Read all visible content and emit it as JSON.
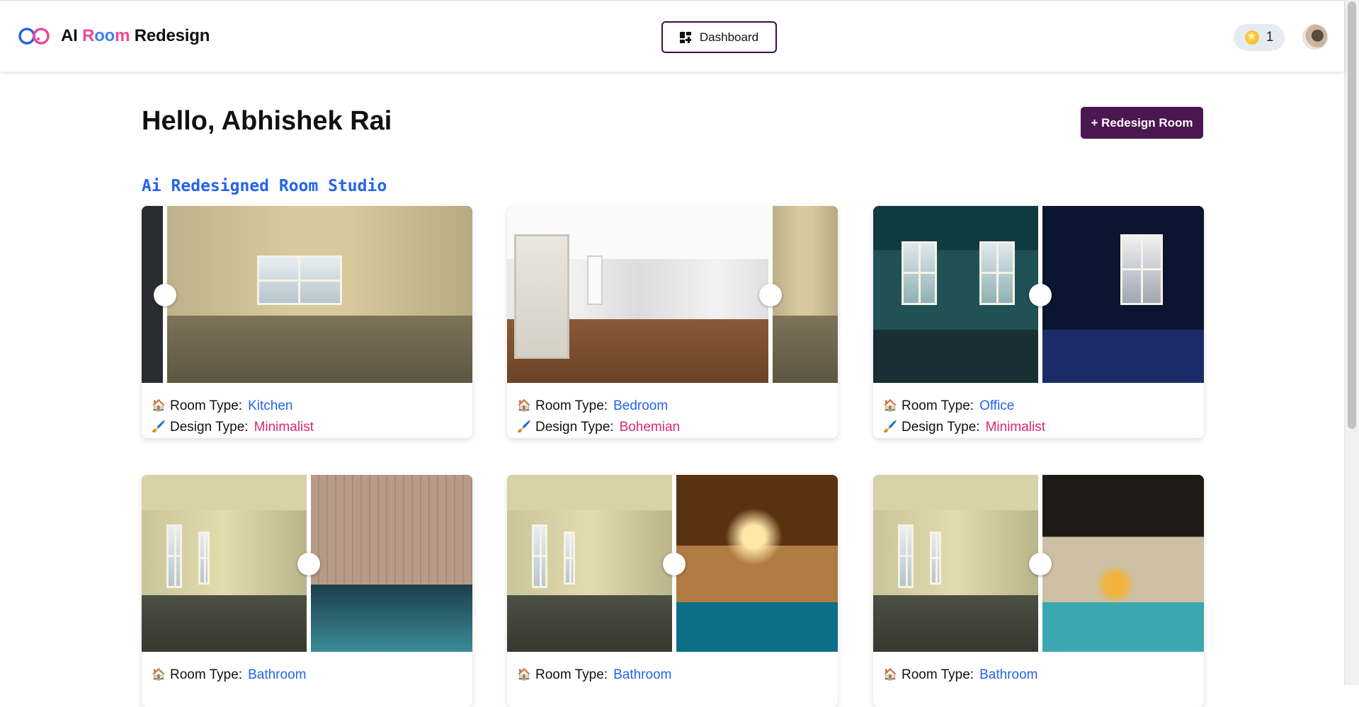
{
  "app": {
    "name_part1": "AI",
    "name_part2_room_r": "R",
    "name_part2_room_o": "oo",
    "name_part2_room_m": "m",
    "name_part3": "Redesign"
  },
  "header": {
    "dashboard_label": "Dashboard",
    "credits": "1"
  },
  "main": {
    "greeting": "Hello, Abhishek Rai",
    "redesign_button": "+ Redesign Room",
    "studio_title": "Ai Redesigned Room Studio",
    "room_type_label": "Room Type:",
    "design_type_label": "Design Type:"
  },
  "cards": [
    {
      "room_type": "Kitchen",
      "design_type": "Minimalist"
    },
    {
      "room_type": "Bedroom",
      "design_type": "Bohemian"
    },
    {
      "room_type": "Office",
      "design_type": "Minimalist"
    },
    {
      "room_type": "Bathroom",
      "design_type": ""
    },
    {
      "room_type": "Bathroom",
      "design_type": ""
    },
    {
      "room_type": "Bathroom",
      "design_type": ""
    }
  ],
  "colors": {
    "brand_purple": "#4a1751",
    "room_type_value": "#2563eb",
    "design_type_value": "#db2777",
    "studio_title": "#2563eb"
  },
  "icons": {
    "logo": "infinity-loop-icon",
    "dashboard": "dashboard-grid-icon",
    "credits": "star-coin-icon",
    "room_type": "house-icon",
    "design_type": "paintbrush-icon"
  }
}
